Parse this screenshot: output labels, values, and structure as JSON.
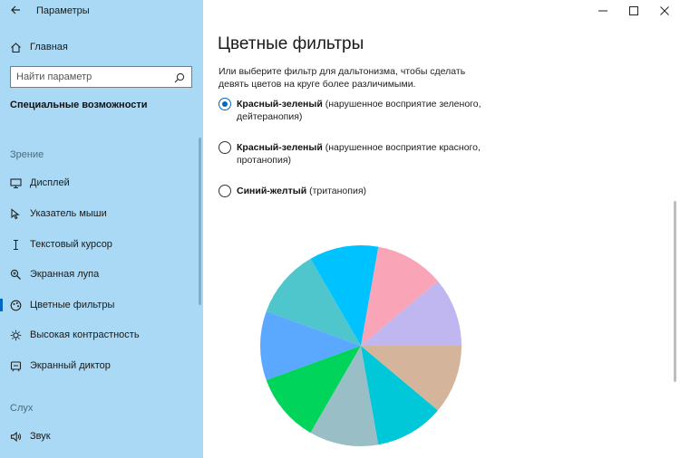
{
  "window": {
    "title": "Параметры",
    "controls": [
      "—",
      "☐",
      "✕"
    ]
  },
  "sidebar": {
    "home_label": "Главная",
    "search_placeholder": "Найти параметр",
    "section_title": "Специальные возможности",
    "groups": [
      {
        "label": "Зрение",
        "items": [
          {
            "label": "Дисплей",
            "icon": "monitor-icon",
            "active": false
          },
          {
            "label": "Указатель мыши",
            "icon": "mouse-pointer-icon",
            "active": false
          },
          {
            "label": "Текстовый курсор",
            "icon": "text-cursor-icon",
            "active": false
          },
          {
            "label": "Экранная лупа",
            "icon": "magnifier-icon",
            "active": false
          },
          {
            "label": "Цветные фильтры",
            "icon": "color-filter-icon",
            "active": true
          },
          {
            "label": "Высокая контрастность",
            "icon": "contrast-icon",
            "active": false
          },
          {
            "label": "Экранный диктор",
            "icon": "narrator-icon",
            "active": false
          }
        ]
      },
      {
        "label": "Слух",
        "items": [
          {
            "label": "Звук",
            "icon": "speaker-icon",
            "active": false
          }
        ]
      }
    ]
  },
  "main": {
    "title": "Цветные фильтры",
    "description": "Или выберите фильтр для дальтонизма, чтобы сделать девять цветов на круге более различимыми.",
    "options": [
      {
        "bold": "Красный-зеленый",
        "rest": " (нарушенное восприятие зеленого, дейтеранопия)",
        "checked": true
      },
      {
        "bold": "Красный-зеленый",
        "rest": " (нарушенное восприятие красного, протанопия)",
        "checked": false
      },
      {
        "bold": "Синий-желтый",
        "rest": " (тританопия)",
        "checked": false
      }
    ],
    "color_wheel": {
      "slices": 9,
      "colors": [
        "#c0b6f0",
        "#f9a5b7",
        "#00c2ff",
        "#4ec6cb",
        "#5aa8ff",
        "#00d45a",
        "#99bec6",
        "#00c8d8",
        "#d4b49a"
      ]
    }
  },
  "colors": {
    "sidebar_bg": "#a9d9f4",
    "accent": "#0067c0"
  }
}
